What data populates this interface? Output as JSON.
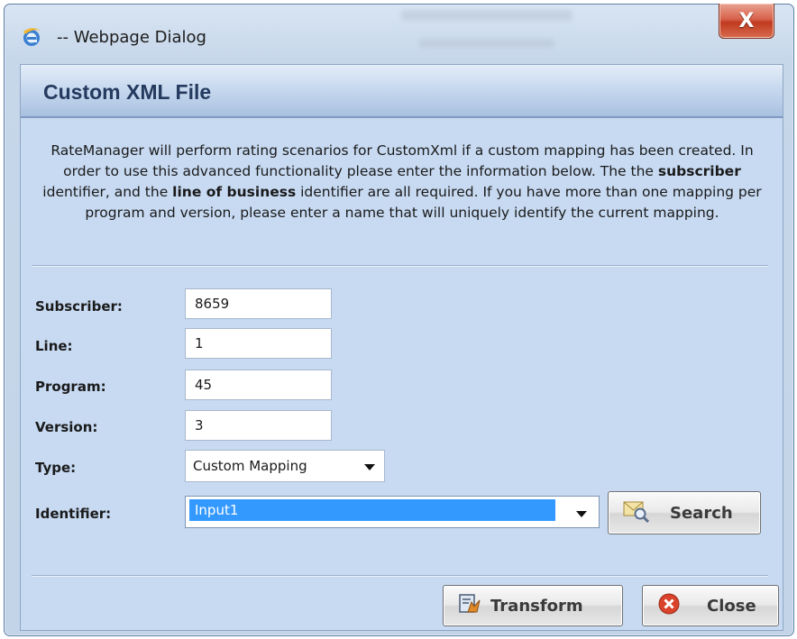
{
  "window": {
    "title": "-- Webpage Dialog",
    "close_glyph": "X",
    "app_icon": "ie-logo-icon"
  },
  "dialog": {
    "heading": "Custom XML File",
    "description": {
      "p1": "RateManager will perform rating scenarios for CustomXml if a custom mapping has been created. In order to use this advanced functionality please enter the information below. The the ",
      "b1": "subscriber",
      "p2": " identifier, and the ",
      "b2": "line of business",
      "p3": " identifier are all required. If you have more than one mapping per program and version, please enter a name that will uniquely identify the current mapping."
    }
  },
  "form": {
    "subscriber": {
      "label": "Subscriber:",
      "value": "8659"
    },
    "line": {
      "label": "Line:",
      "value": "1"
    },
    "program": {
      "label": "Program:",
      "value": "45"
    },
    "version": {
      "label": "Version:",
      "value": "3"
    },
    "type": {
      "label": "Type:",
      "value": "Custom Mapping"
    },
    "identifier": {
      "label": "Identifier:",
      "value": "Input1"
    }
  },
  "buttons": {
    "search": "Search",
    "transform": "Transform",
    "close": "Close"
  },
  "colors": {
    "client_bg": "#c7daf2",
    "selection": "#3399ff",
    "close_icon": "#d9432c"
  }
}
